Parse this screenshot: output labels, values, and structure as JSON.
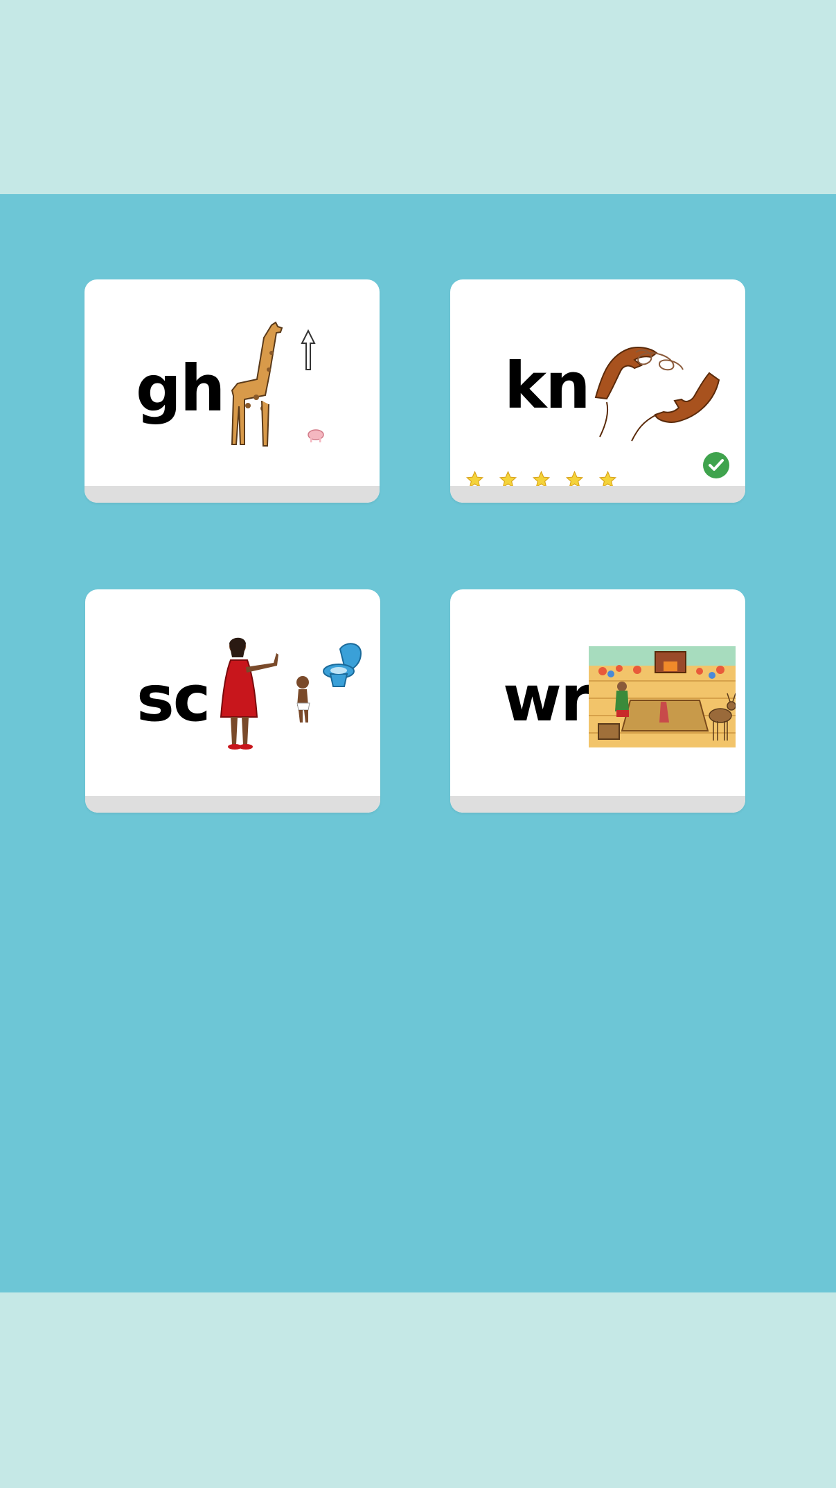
{
  "cards": [
    {
      "word": "gh",
      "image": "giraffe-arrow-pig-picture",
      "completed": false
    },
    {
      "word": "kn",
      "image": "hands-knot-picture",
      "completed": true,
      "stars": 5
    },
    {
      "word": "sc",
      "image": "woman-child-toilet-picture",
      "completed": false
    },
    {
      "word": "wr",
      "image": "workshop-scene-picture",
      "completed": false
    }
  ],
  "colors": {
    "outer_band": "#c5e8e6",
    "main_background": "#6dc6d6",
    "card": "#ffffff",
    "card_base": "#dedede",
    "star": "#f4d33a",
    "check": "#3fa34d"
  }
}
